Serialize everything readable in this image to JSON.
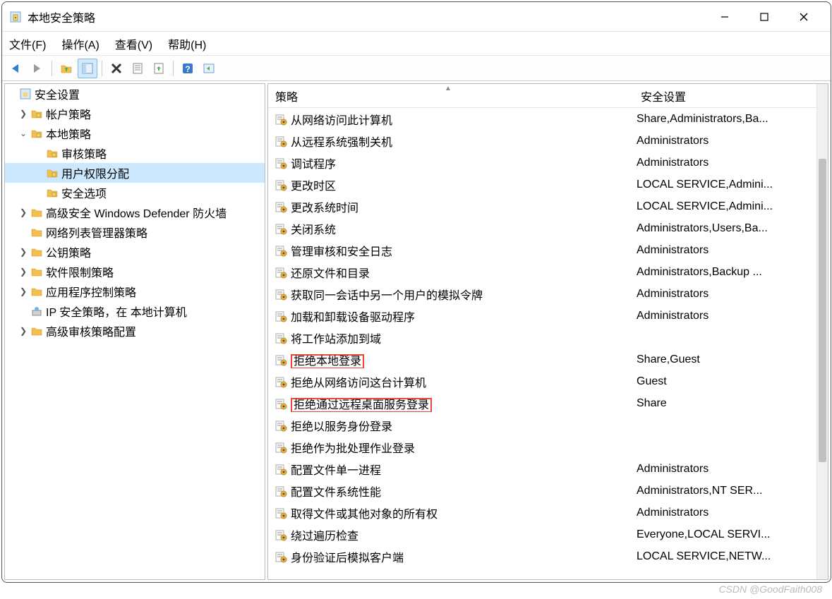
{
  "window": {
    "title": "本地安全策略"
  },
  "menu": {
    "file": "文件(F)",
    "action": "操作(A)",
    "view": "查看(V)",
    "help": "帮助(H)"
  },
  "tree": {
    "root": "安全设置",
    "account_policy": "帐户策略",
    "local_policy": "本地策略",
    "audit_policy": "审核策略",
    "user_rights": "用户权限分配",
    "security_options": "安全选项",
    "defender": "高级安全 Windows Defender 防火墙",
    "network_list": "网络列表管理器策略",
    "public_key": "公钥策略",
    "software_restrict": "软件限制策略",
    "app_control": "应用程序控制策略",
    "ipsec": "IP 安全策略，在 本地计算机",
    "adv_audit": "高级审核策略配置"
  },
  "headers": {
    "policy": "策略",
    "setting": "安全设置"
  },
  "policies": [
    {
      "name": "从网络访问此计算机",
      "setting": "Share,Administrators,Ba...",
      "boxed": false
    },
    {
      "name": "从远程系统强制关机",
      "setting": "Administrators",
      "boxed": false
    },
    {
      "name": "调试程序",
      "setting": "Administrators",
      "boxed": false
    },
    {
      "name": "更改时区",
      "setting": "LOCAL SERVICE,Admini...",
      "boxed": false
    },
    {
      "name": "更改系统时间",
      "setting": "LOCAL SERVICE,Admini...",
      "boxed": false
    },
    {
      "name": "关闭系统",
      "setting": "Administrators,Users,Ba...",
      "boxed": false
    },
    {
      "name": "管理审核和安全日志",
      "setting": "Administrators",
      "boxed": false
    },
    {
      "name": "还原文件和目录",
      "setting": "Administrators,Backup ...",
      "boxed": false
    },
    {
      "name": "获取同一会话中另一个用户的模拟令牌",
      "setting": "Administrators",
      "boxed": false
    },
    {
      "name": "加载和卸载设备驱动程序",
      "setting": "Administrators",
      "boxed": false
    },
    {
      "name": "将工作站添加到域",
      "setting": "",
      "boxed": false
    },
    {
      "name": "拒绝本地登录",
      "setting": "Share,Guest",
      "boxed": true
    },
    {
      "name": "拒绝从网络访问这台计算机",
      "setting": "Guest",
      "boxed": false
    },
    {
      "name": "拒绝通过远程桌面服务登录",
      "setting": "Share",
      "boxed": true
    },
    {
      "name": "拒绝以服务身份登录",
      "setting": "",
      "boxed": false
    },
    {
      "name": "拒绝作为批处理作业登录",
      "setting": "",
      "boxed": false
    },
    {
      "name": "配置文件单一进程",
      "setting": "Administrators",
      "boxed": false
    },
    {
      "name": "配置文件系统性能",
      "setting": "Administrators,NT SER...",
      "boxed": false
    },
    {
      "name": "取得文件或其他对象的所有权",
      "setting": "Administrators",
      "boxed": false
    },
    {
      "name": "绕过遍历检查",
      "setting": "Everyone,LOCAL SERVI...",
      "boxed": false
    },
    {
      "name": "身份验证后模拟客户端",
      "setting": "LOCAL SERVICE,NETW...",
      "boxed": false
    }
  ],
  "watermark": "CSDN @GoodFaith008"
}
